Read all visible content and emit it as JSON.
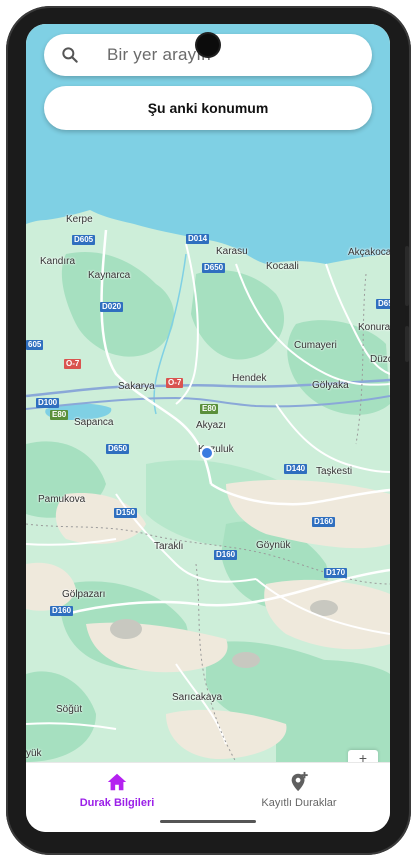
{
  "search": {
    "placeholder": "Bir yer arayın"
  },
  "location_button": {
    "label": "Şu anki konumum"
  },
  "map": {
    "places": [
      {
        "name": "Kerpe"
      },
      {
        "name": "Karasu"
      },
      {
        "name": "Akçakoca"
      },
      {
        "name": "Kandıra"
      },
      {
        "name": "Kaynarca"
      },
      {
        "name": "Kocaali"
      },
      {
        "name": "Cumayeri"
      },
      {
        "name": "Konura"
      },
      {
        "name": "Düzce"
      },
      {
        "name": "Sakarya"
      },
      {
        "name": "Hendek"
      },
      {
        "name": "Gölyaka"
      },
      {
        "name": "Sapanca"
      },
      {
        "name": "Akyazı"
      },
      {
        "name": "Kuzuluk"
      },
      {
        "name": "Taşkesti"
      },
      {
        "name": "Pamukova"
      },
      {
        "name": "Taraklı"
      },
      {
        "name": "Göynük"
      },
      {
        "name": "Gölpazarı"
      },
      {
        "name": "Sarıcakaya"
      },
      {
        "name": "Söğüt"
      },
      {
        "name": "yük"
      }
    ],
    "roads": [
      {
        "label": "D605",
        "color": "blue"
      },
      {
        "label": "D014",
        "color": "blue"
      },
      {
        "label": "D650",
        "color": "blue"
      },
      {
        "label": "D020",
        "color": "blue"
      },
      {
        "label": "D650",
        "color": "blue"
      },
      {
        "label": "O-7",
        "color": "red"
      },
      {
        "label": "O-7",
        "color": "red"
      },
      {
        "label": "D100",
        "color": "blue"
      },
      {
        "label": "E80",
        "color": "green"
      },
      {
        "label": "E80",
        "color": "green"
      },
      {
        "label": "D140",
        "color": "blue"
      },
      {
        "label": "D150",
        "color": "blue"
      },
      {
        "label": "D160",
        "color": "blue"
      },
      {
        "label": "D160",
        "color": "blue"
      },
      {
        "label": "D170",
        "color": "blue"
      },
      {
        "label": "D160",
        "color": "blue"
      },
      {
        "label": "D65",
        "color": "blue"
      },
      {
        "label": "605",
        "color": "blue"
      }
    ],
    "colors": {
      "sea": "#7fd0e4",
      "land": "#c9ecd6",
      "forest": "#9ddcb8",
      "road": "#ffffff",
      "highway": "#8aa8d8"
    }
  },
  "nav": {
    "items": [
      {
        "label": "Durak Bilgileri",
        "icon": "home-icon",
        "active": true
      },
      {
        "label": "Kayıtlı Duraklar",
        "icon": "add-location-icon",
        "active": false
      }
    ],
    "active_color": "#9b1fe8",
    "inactive_color": "#666666"
  }
}
